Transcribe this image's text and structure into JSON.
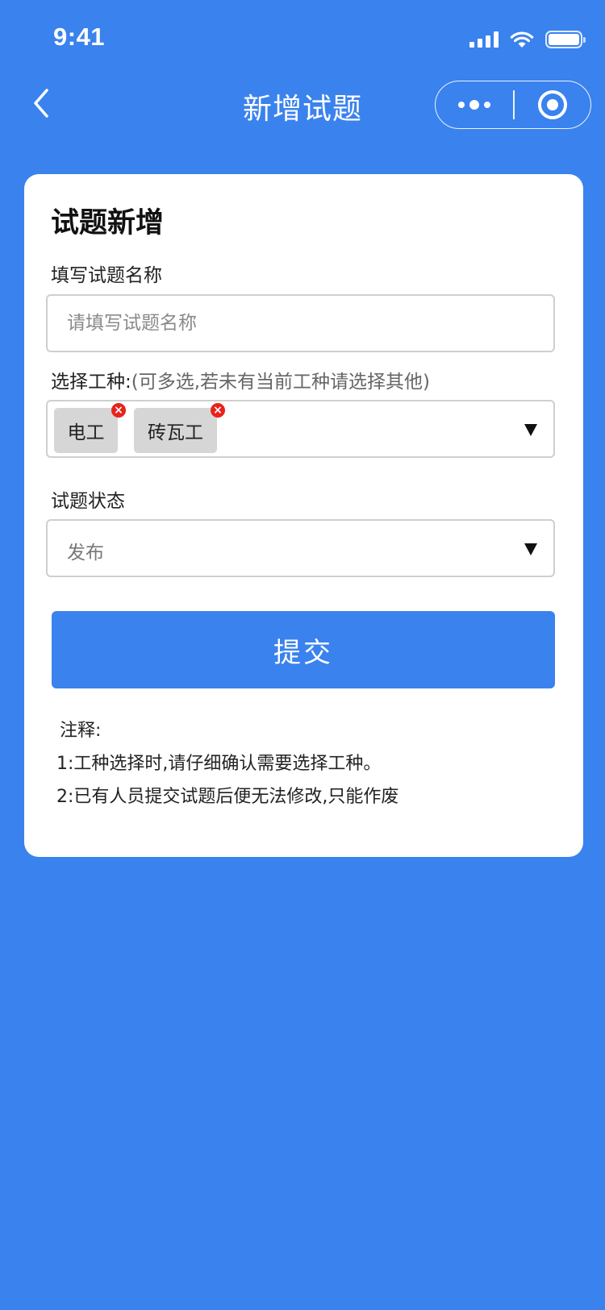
{
  "status_bar": {
    "time": "9:41",
    "icons": [
      "signal-icon",
      "wifi-icon",
      "battery-icon"
    ]
  },
  "nav": {
    "title": "新增试题",
    "back_icon": "chevron-left-icon",
    "more_icon": "more-dots-icon",
    "close_icon": "record-circle-icon"
  },
  "form": {
    "heading": "试题新增",
    "name_label": "填写试题名称",
    "name_placeholder": "请填写试题名称",
    "name_value": "",
    "trade_label": "选择工种:",
    "trade_hint": "(可多选,若未有当前工种请选择其他)",
    "trade_tags": [
      "电工",
      "砖瓦工"
    ],
    "status_label": "试题状态",
    "status_value": "发布",
    "submit_label": "提交"
  },
  "notes": {
    "title": "注释:",
    "items": [
      "1:工种选择时,请仔细确认需要选择工种。",
      "2:已有人员提交试题后便无法修改,只能作废"
    ]
  },
  "colors": {
    "primary": "#3A82EE",
    "card": "#FFFFFF",
    "tag_bg": "#D6D6D6",
    "tag_remove": "#E8231B"
  }
}
